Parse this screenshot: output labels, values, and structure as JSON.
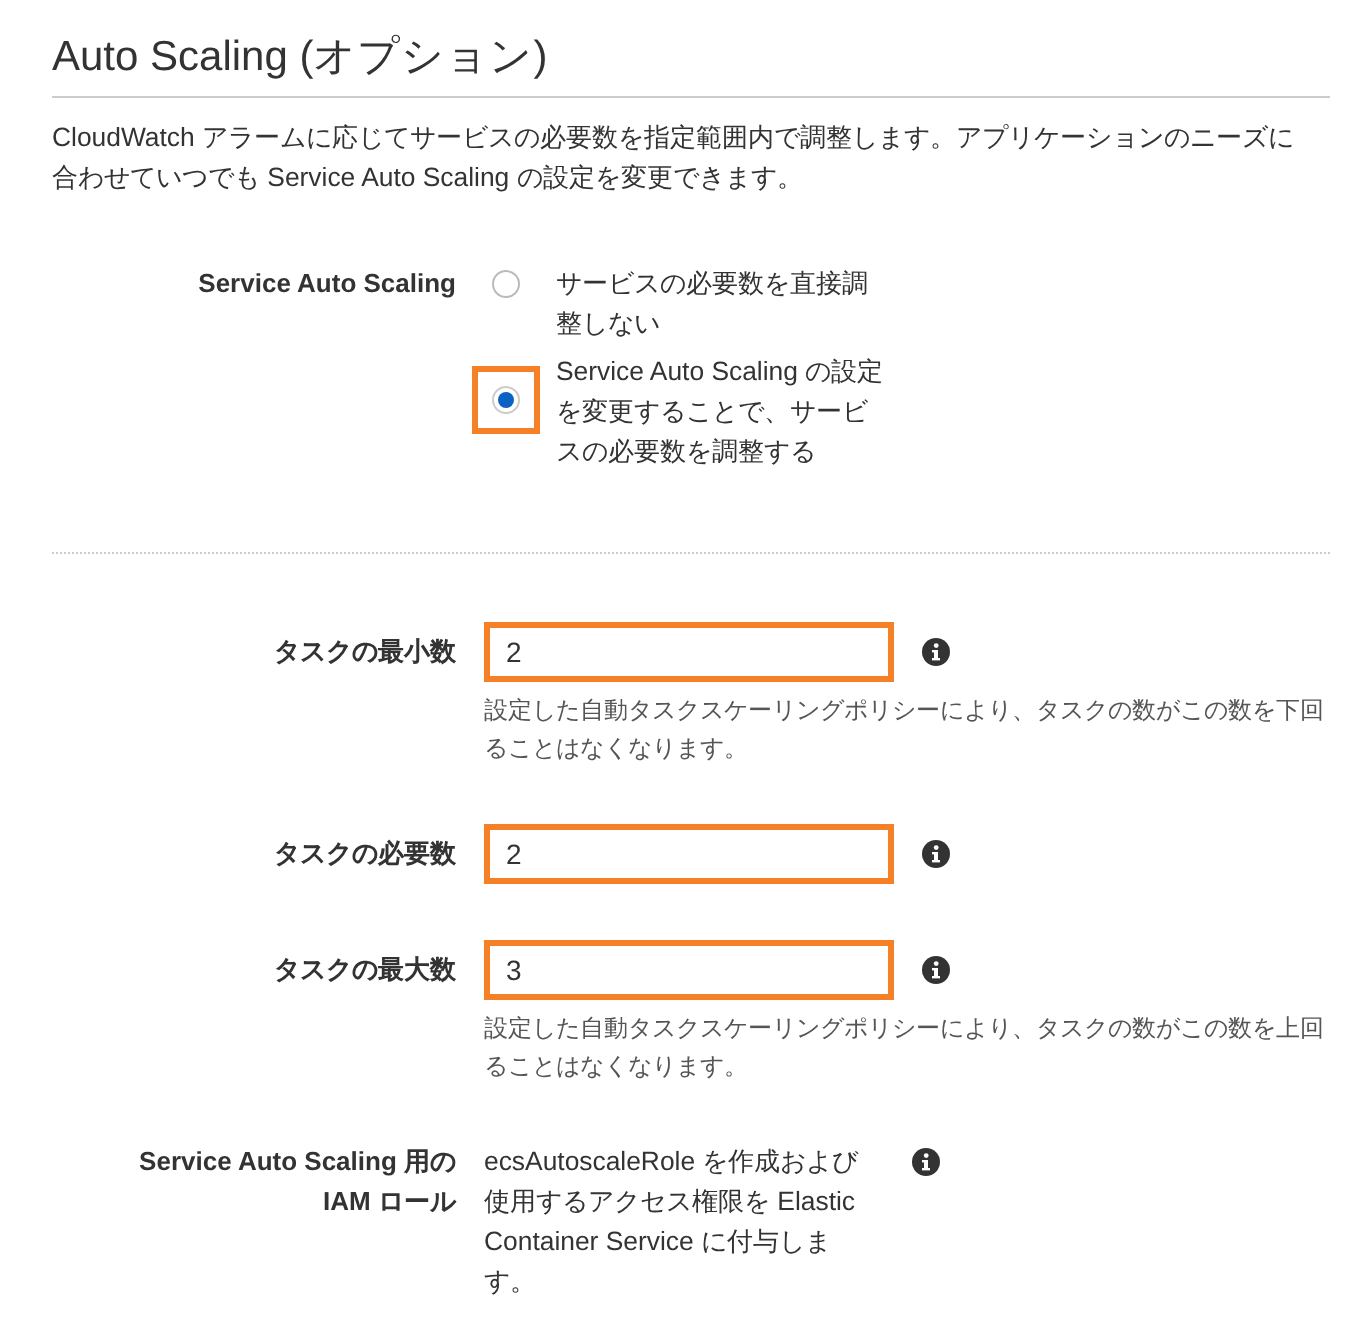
{
  "section": {
    "title": "Auto Scaling (オプション)",
    "description": "CloudWatch アラームに応じてサービスの必要数を指定範囲内で調整します。アプリケーションのニーズに合わせていつでも Service Auto Scaling の設定を変更できます。"
  },
  "service_auto_scaling": {
    "label": "Service Auto Scaling",
    "options": [
      {
        "label": "サービスの必要数を直接調整しない",
        "selected": false,
        "highlighted": false
      },
      {
        "label": "Service Auto Scaling の設定を変更することで、サービスの必要数を調整する",
        "selected": true,
        "highlighted": true
      }
    ]
  },
  "fields": [
    {
      "label": "タスクの最小数",
      "value": "2",
      "highlighted": true,
      "help": "設定した自動タスクスケーリングポリシーにより、タスクの数がこの数を下回ることはなくなります。"
    },
    {
      "label": "タスクの必要数",
      "value": "2",
      "highlighted": true
    },
    {
      "label": "タスクの最大数",
      "value": "3",
      "highlighted": true,
      "help": "設定した自動タスクスケーリングポリシーにより、タスクの数がこの数を上回ることはなくなります。"
    }
  ],
  "iam_role": {
    "label_lines": [
      "Service Auto Scaling 用の",
      "IAM ロール"
    ],
    "description": "ecsAutoscaleRole を作成および使用するアクセス権限を Elastic Container Service に付与します。"
  }
}
